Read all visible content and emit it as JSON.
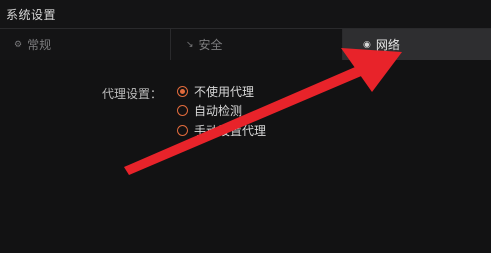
{
  "window": {
    "title": "系统设置"
  },
  "tabs": [
    {
      "label": "常规",
      "icon": "gear-icon",
      "active": false
    },
    {
      "label": "安全",
      "icon": "shield-icon",
      "active": false
    },
    {
      "label": "网络",
      "icon": "globe-icon",
      "active": true
    }
  ],
  "proxy": {
    "label": "代理设置：",
    "options": [
      {
        "label": "不使用代理",
        "selected": true
      },
      {
        "label": "自动检测",
        "selected": false
      },
      {
        "label": "手动设置代理",
        "selected": false
      }
    ]
  },
  "colors": {
    "accent": "#e06a3c",
    "annotation_arrow": "#e8232a",
    "active_tab_bg": "#2e2e30"
  }
}
